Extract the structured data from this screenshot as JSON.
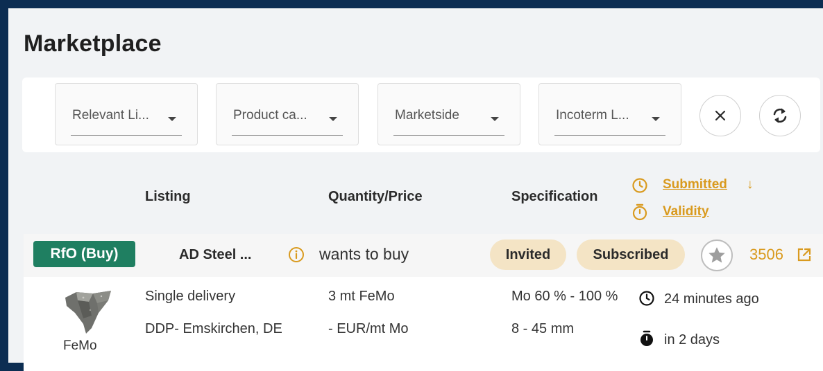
{
  "page": {
    "title": "Marketplace"
  },
  "filters": [
    {
      "label": "Relevant Li..."
    },
    {
      "label": "Product ca..."
    },
    {
      "label": "Marketside"
    },
    {
      "label": "Incoterm L..."
    }
  ],
  "filter_actions": {
    "clear_icon": "close-icon",
    "refresh_icon": "refresh-icon"
  },
  "columns": {
    "listing": "Listing",
    "quantity_price": "Quantity/Price",
    "specification": "Specification",
    "submitted": "Submitted",
    "submitted_sort_arrow": "↓",
    "validity": "Validity"
  },
  "listing": {
    "type_badge": "RfO (Buy)",
    "company": "AD Steel ...",
    "intent": "wants to buy",
    "status_badges": [
      "Invited",
      "Subscribed"
    ],
    "id": "3506",
    "product_name": "FeMo",
    "delivery": "Single delivery",
    "incoterm_location": "DDP- Emskirchen, DE",
    "quantity": "3 mt FeMo",
    "price": "- EUR/mt Mo",
    "spec_content": "Mo 60 % - 100 %",
    "spec_size": "8 - 45 mm",
    "submitted_time": "24 minutes ago",
    "validity_time": "in 2 days"
  },
  "colors": {
    "page_frame": "#0c2d52",
    "accent": "#d99a1e",
    "badge_green": "#1f7f61",
    "pill_bg": "#f4e4c5"
  }
}
